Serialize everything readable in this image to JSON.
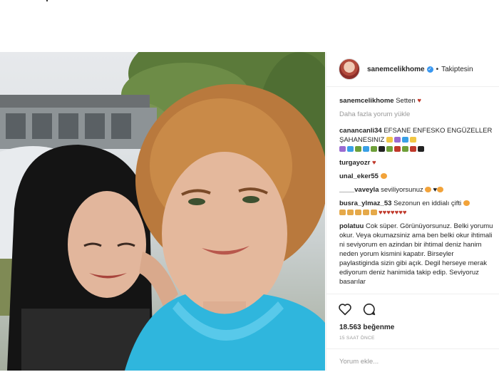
{
  "post": {
    "username": "sanemcelikhome",
    "separator": "•",
    "follow_status": "Takiptesin"
  },
  "caption": {
    "user": "sanemcelikhome",
    "text": "Setten",
    "emoji": "lips-icon"
  },
  "load_more": "Daha fazla yorum yükle",
  "comments": [
    {
      "user": "canancanli34",
      "text": "EFSANE ENFESKO ENGÜZELLER ŞAHANESINIZ"
    },
    {
      "user": "turgayozr",
      "text": ""
    },
    {
      "user": "unal_eker55",
      "text": ""
    },
    {
      "user": "____vaveyla",
      "text": "seviliyorsunuz"
    },
    {
      "user": "busra_ylmaz_53",
      "text": "Sezonun en iddialı çifti"
    },
    {
      "user": "polatuu",
      "text": "Cok süper. Görünüyorsunuz. Belki yorumu okur. Veya okumazsiniz ama ben belki okur ihtimali ni seviyorum en azindan bir ihtimal deniz hanim neden yorum kismini kapatır. Birseyler paylastiginda sizin gibi açık. Degil herseye merak ediyorum deniz hanimida takip edip. Seviyoruz basarılar"
    }
  ],
  "likes": "18.563 beğenme",
  "time_ago": "15 SAAT ÖNCE",
  "comment_input": {
    "placeholder": "Yorum ekle..."
  },
  "colors": {
    "accent": "#3897f0",
    "heart": "#c0392b",
    "muted": "#999999"
  }
}
